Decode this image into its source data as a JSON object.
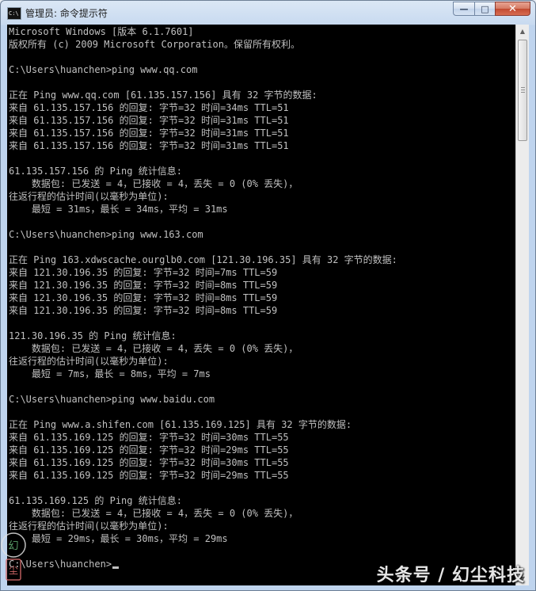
{
  "window": {
    "title": "管理员: 命令提示符",
    "app_icon_text": "C:\\",
    "minimize_label": "—",
    "maximize_label": "□",
    "close_label": "✕"
  },
  "console": {
    "lines": [
      "Microsoft Windows [版本 6.1.7601]",
      "版权所有 (c) 2009 Microsoft Corporation。保留所有权利。",
      "",
      "C:\\Users\\huanchen>ping www.qq.com",
      "",
      "正在 Ping www.qq.com [61.135.157.156] 具有 32 字节的数据:",
      "来自 61.135.157.156 的回复: 字节=32 时间=34ms TTL=51",
      "来自 61.135.157.156 的回复: 字节=32 时间=31ms TTL=51",
      "来自 61.135.157.156 的回复: 字节=32 时间=31ms TTL=51",
      "来自 61.135.157.156 的回复: 字节=32 时间=31ms TTL=51",
      "",
      "61.135.157.156 的 Ping 统计信息:",
      "    数据包: 已发送 = 4，已接收 = 4，丢失 = 0 (0% 丢失)，",
      "往返行程的估计时间(以毫秒为单位):",
      "    最短 = 31ms，最长 = 34ms，平均 = 31ms",
      "",
      "C:\\Users\\huanchen>ping www.163.com",
      "",
      "正在 Ping 163.xdwscache.ourglb0.com [121.30.196.35] 具有 32 字节的数据:",
      "来自 121.30.196.35 的回复: 字节=32 时间=7ms TTL=59",
      "来自 121.30.196.35 的回复: 字节=32 时间=8ms TTL=59",
      "来自 121.30.196.35 的回复: 字节=32 时间=8ms TTL=59",
      "来自 121.30.196.35 的回复: 字节=32 时间=8ms TTL=59",
      "",
      "121.30.196.35 的 Ping 统计信息:",
      "    数据包: 已发送 = 4，已接收 = 4，丢失 = 0 (0% 丢失)，",
      "往返行程的估计时间(以毫秒为单位):",
      "    最短 = 7ms，最长 = 8ms，平均 = 7ms",
      "",
      "C:\\Users\\huanchen>ping www.baidu.com",
      "",
      "正在 Ping www.a.shifen.com [61.135.169.125] 具有 32 字节的数据:",
      "来自 61.135.169.125 的回复: 字节=32 时间=30ms TTL=55",
      "来自 61.135.169.125 的回复: 字节=32 时间=29ms TTL=55",
      "来自 61.135.169.125 的回复: 字节=32 时间=30ms TTL=55",
      "来自 61.135.169.125 的回复: 字节=32 时间=29ms TTL=55",
      "",
      "61.135.169.125 的 Ping 统计信息:",
      "    数据包: 已发送 = 4，已接收 = 4，丢失 = 0 (0% 丢失)，",
      "往返行程的估计时间(以毫秒为单位):",
      "    最短 = 29ms，最长 = 30ms，平均 = 29ms",
      "",
      "C:\\Users\\huanchen>"
    ]
  },
  "colors": {
    "console_bg": "#000000",
    "console_fg": "#c0c0c0",
    "titlebar": "#c8daf0",
    "close_button": "#c24a31"
  },
  "icons": {
    "app": "cmd-icon",
    "scroll_up": "scroll-up-arrow-icon",
    "scroll_down": "scroll-down-arrow-icon"
  },
  "watermark": {
    "text": "头条号 / 幻尘科技",
    "seal_text": "幻尘"
  }
}
